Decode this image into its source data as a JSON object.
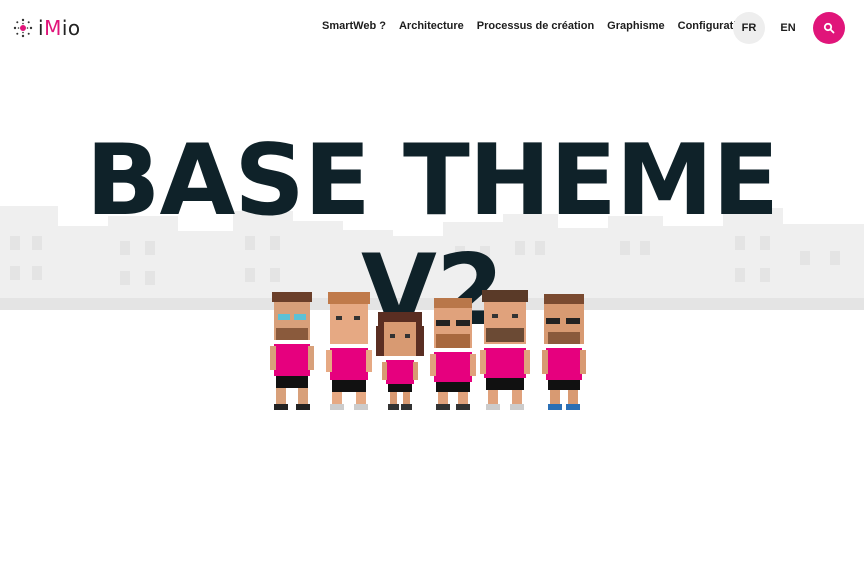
{
  "brand": {
    "logo_prefix": "i",
    "logo_m": "M",
    "logo_suffix": "io"
  },
  "nav": {
    "items": [
      {
        "label": "SmartWeb ?"
      },
      {
        "label": "Architecture"
      },
      {
        "label": "Processus de création"
      },
      {
        "label": "Graphisme"
      },
      {
        "label": "Configuration"
      }
    ]
  },
  "languages": {
    "fr": "FR",
    "en": "EN",
    "active": "FR"
  },
  "search": {
    "icon": "search-icon"
  },
  "hero": {
    "title": "BASE THEME V2"
  },
  "colors": {
    "accent": "#e0157a",
    "title": "#0f2229",
    "skyline": "#eeeeee"
  }
}
